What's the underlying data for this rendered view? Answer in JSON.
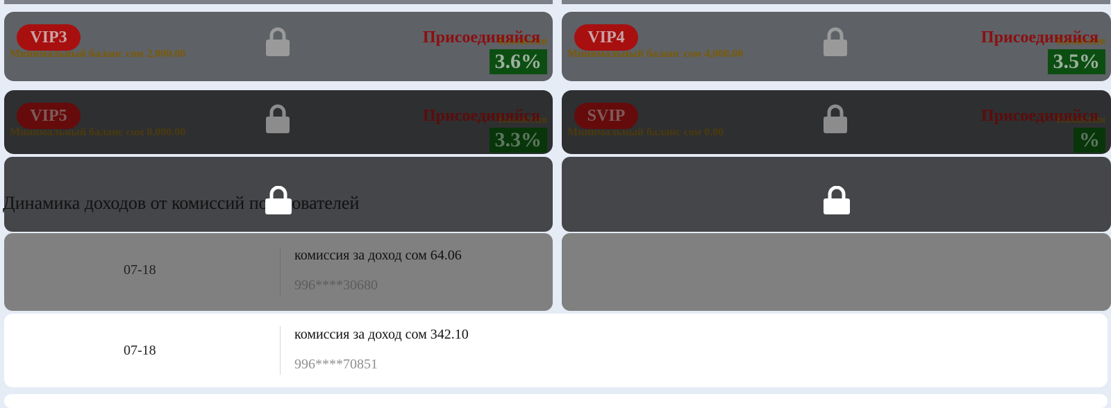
{
  "tiers": [
    {
      "name": "VIP3",
      "min_balance": "Минимальный баланс сом 2,000.00",
      "join": "Присоединяйся",
      "commission_label": "Комиссия",
      "rate": "3.6%"
    },
    {
      "name": "VIP4",
      "min_balance": "Минимальный баланс сом 4,000.00",
      "join": "Присоединяйся",
      "commission_label": "Комиссия",
      "rate": "3.5%"
    },
    {
      "name": "VIP5",
      "min_balance": "Минимальный баланс сом 8,000.00",
      "join": "Присоединяйся",
      "commission_label": "Комиссия",
      "rate": "3.3%"
    },
    {
      "name": "SVIP",
      "min_balance": "Минимальный баланс сом 0.00",
      "join": "Присоединяйся",
      "commission_label": "Комиссия",
      "rate": "%"
    }
  ],
  "section_title": "Динамика доходов от комиссий пользователей",
  "records": [
    {
      "date": "07-18",
      "commission": "комиссия за доход сом 64.06",
      "phone": "996****30680"
    },
    {
      "date": "07-18",
      "commission": "комиссия за доход сом 342.10",
      "phone": "996****70851"
    }
  ],
  "icons": {
    "lock": "lock-icon"
  }
}
